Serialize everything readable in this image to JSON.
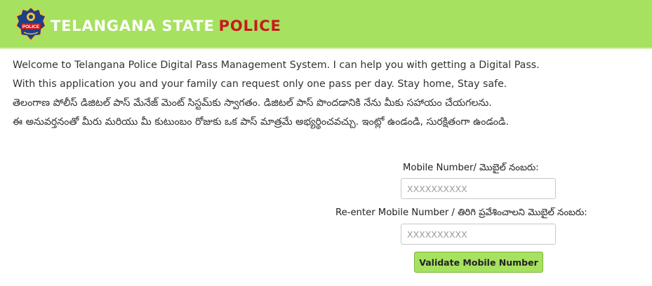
{
  "header": {
    "brand_part1": "TELANGANA STATE",
    "brand_part2": "POLICE",
    "logo_text": "POLICE",
    "logo_icon": "police-badge-icon"
  },
  "intro": {
    "line1": "Welcome to Telangana Police Digital Pass Management System. I can help you with getting a Digital Pass.",
    "line2": "With this application you and your family can request only one pass per day. Stay home, Stay safe.",
    "line3": "తెలంగాణ పోలీస్ డిజిటల్ పాస్ మేనేజ్ మెంట్ సిస్టమ్‌కు స్వాగతం. డిజిటల్ పాస్ పొందడానికి నేను మీకు సహాయం చేయగలను.",
    "line4": "ఈ అనువర్తనంతో మీరు మరియు మీ కుటుంబం రోజుకు ఒక పాస్ మాత్రమే అభ్యర్థించవచ్చు. ఇంట్లో ఉండండి, సురక్షితంగా ఉండండి."
  },
  "form": {
    "mobile_label": "Mobile Number/ మొబైల్ నంబరు:",
    "mobile_placeholder": "XXXXXXXXXX",
    "reenter_label": "Re-enter Mobile Number / తిరిగి ప్రవేశించాలని మొబైల్ నంబరు:",
    "reenter_placeholder": "XXXXXXXXXX",
    "validate_button": "Validate Mobile Number"
  },
  "colors": {
    "header_bg": "#a6e160",
    "brand_accent": "#c8191c",
    "button_bg": "#a6e160"
  }
}
